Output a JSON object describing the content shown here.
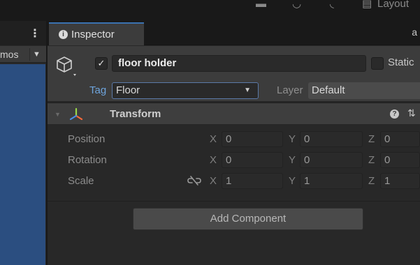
{
  "topbar": {
    "layout_label": "Layout"
  },
  "left_panel": {
    "menu_glyph": "⋮",
    "gizmos_label": "mos",
    "caret": "▼"
  },
  "inspector": {
    "tab_label": "Inspector",
    "info_glyph": "i",
    "lock_glyph": "a",
    "checkmark": "✓",
    "object_name": "floor holder",
    "static_label": "Static",
    "tag_label": "Tag",
    "tag_value": "Floor",
    "tag_caret": "▼",
    "layer_label": "Layer",
    "layer_value": "Default"
  },
  "transform": {
    "fold_glyph": "▼",
    "title": "Transform",
    "help_glyph": "?",
    "preset_glyph": "⇅",
    "axis_x": "X",
    "axis_y": "Y",
    "axis_z": "Z",
    "rows": [
      {
        "label": "Position",
        "x": "0",
        "y": "0",
        "z": "0"
      },
      {
        "label": "Rotation",
        "x": "0",
        "y": "0",
        "z": "0"
      },
      {
        "label": "Scale",
        "x": "1",
        "y": "1",
        "z": "1"
      }
    ]
  },
  "add_component_label": "Add Component",
  "colors": {
    "accent_blue": "#3a72b0",
    "tag_blue": "#6ea4dc",
    "scene_blue": "#2b4e80",
    "panel_bg": "#282828"
  }
}
